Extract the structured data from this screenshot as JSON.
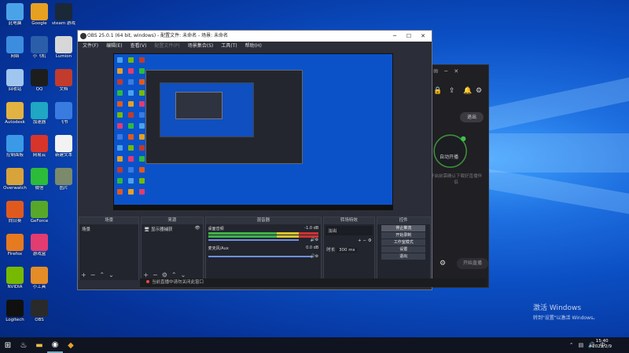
{
  "desktop": {
    "icons": [
      {
        "label": "此电脑",
        "color": "#4aa3e8",
        "col": 0,
        "row": 0
      },
      {
        "label": "Google",
        "color": "#e8a020",
        "col": 1,
        "row": 0
      },
      {
        "label": "steam 游戏",
        "color": "#1b2838",
        "col": 2,
        "row": 0
      },
      {
        "label": "网络",
        "color": "#3c8de0",
        "col": 0,
        "row": 1
      },
      {
        "label": "小飞机",
        "color": "#2b5ea8",
        "col": 1,
        "row": 1
      },
      {
        "label": "Lumion",
        "color": "#d7d7d7",
        "col": 2,
        "row": 1
      },
      {
        "label": "回收站",
        "color": "#9ec6ef",
        "col": 0,
        "row": 2
      },
      {
        "label": "QQ",
        "color": "#1d1d1d",
        "col": 1,
        "row": 2
      },
      {
        "label": "文档",
        "color": "#c23b2c",
        "col": 2,
        "row": 2
      },
      {
        "label": "Autodesk",
        "color": "#e3b341",
        "col": 0,
        "row": 3
      },
      {
        "label": "加速器",
        "color": "#1fa7c4",
        "col": 1,
        "row": 3
      },
      {
        "label": "飞书",
        "color": "#3a7be0",
        "col": 2,
        "row": 3
      },
      {
        "label": "控制面板",
        "color": "#3a9ae8",
        "col": 0,
        "row": 4
      },
      {
        "label": "网易云",
        "color": "#d8352a",
        "col": 1,
        "row": 4
      },
      {
        "label": "新建文本",
        "color": "#f2f2f2",
        "col": 2,
        "row": 4
      },
      {
        "label": "Overwatch",
        "color": "#d8a33a",
        "col": 0,
        "row": 5
      },
      {
        "label": "微信",
        "color": "#2dbb3a",
        "col": 1,
        "row": 5
      },
      {
        "label": "图片",
        "color": "#7a8a6a",
        "col": 2,
        "row": 5
      },
      {
        "label": "向日葵",
        "color": "#e05a1e",
        "col": 0,
        "row": 6
      },
      {
        "label": "GeForce",
        "color": "#57a828",
        "col": 1,
        "row": 6
      },
      {
        "label": "Firefox",
        "color": "#e57a1f",
        "col": 0,
        "row": 7
      },
      {
        "label": "游戏盒",
        "color": "#e23c70",
        "col": 1,
        "row": 7
      },
      {
        "label": "NVIDIA",
        "color": "#76b900",
        "col": 0,
        "row": 8
      },
      {
        "label": "小工具",
        "color": "#e48c26",
        "col": 1,
        "row": 8
      },
      {
        "label": "Logitech",
        "color": "#101010",
        "col": 0,
        "row": 9
      },
      {
        "label": "OBS",
        "color": "#2a2a2a",
        "col": 1,
        "row": 9
      }
    ]
  },
  "obs": {
    "title": "OBS 25.0.1 (64 bit, windows) - 配置文件: 未命名 - 场景: 未命名",
    "menu": [
      "文件(F)",
      "编辑(E)",
      "查看(V)",
      "配置文件(P)",
      "场景集合(S)",
      "工具(T)",
      "帮助(H)"
    ],
    "docks": {
      "scenes": {
        "title": "场景",
        "item": "场景"
      },
      "sources": {
        "title": "来源",
        "item": "显示器捕获"
      },
      "mixer": {
        "title": "混音器",
        "tracks": [
          {
            "name": "桌面音频",
            "db": "-1.0 dB"
          },
          {
            "name": "麦克风/Aux",
            "db": "0.0 dB"
          }
        ]
      },
      "transitions": {
        "title": "转场特效",
        "type": "淡出",
        "duration_label": "时长",
        "duration": "300 ms"
      },
      "controls": {
        "title": "控件",
        "buttons": [
          "停止推流",
          "开始录制",
          "工作室模式",
          "设置",
          "退出"
        ]
      }
    },
    "status": {
      "live": "LIVE: 00:00:00",
      "rec": "REC: 00:00:00",
      "cpu": "CPU: 3.0%, 30.00 fps"
    }
  },
  "notice": "当前直播中请勿关闭此窗口",
  "bg_app": {
    "exit": "退出",
    "center": "自动开播",
    "tip": "开启前需确认下载好直播伴侣",
    "start": "开始直播"
  },
  "watermark": {
    "line1": "激活 Windows",
    "line2": "转到\"设置\"以激活 Windows。"
  },
  "taskbar": {
    "time": "15:40",
    "date": "2022/2/9"
  }
}
